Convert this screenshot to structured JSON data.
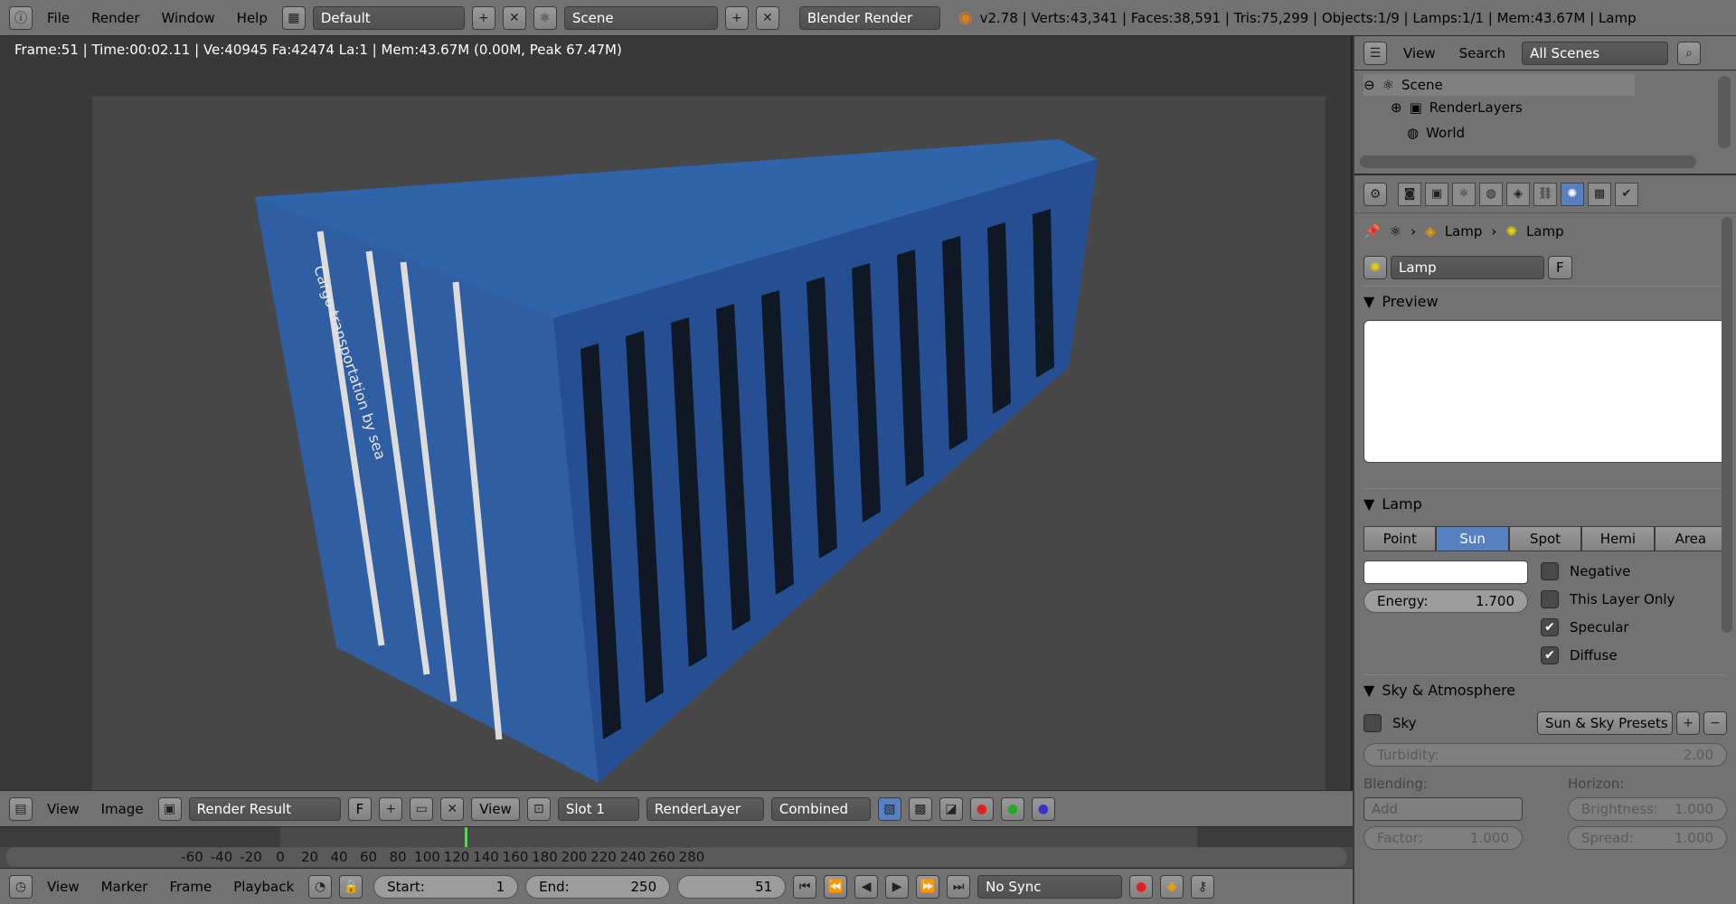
{
  "topbar": {
    "menus": [
      "File",
      "Render",
      "Window",
      "Help"
    ],
    "layout": "Default",
    "scene": "Scene",
    "engine": "Blender Render",
    "stats": "v2.78 | Verts:43,341 | Faces:38,591 | Tris:75,299 | Objects:1/9 | Lamps:1/1 | Mem:43.67M | Lamp"
  },
  "viewport": {
    "info": "Frame:51 | Time:00:02.11 | Ve:40945 Fa:42474 La:1 | Mem:43.67M (0.00M, Peak 67.47M)",
    "container_text": "Cargo transportation by sea"
  },
  "image_bar": {
    "menus": [
      "View",
      "Image"
    ],
    "image_name": "Render Result",
    "fake_user": "F",
    "view_label": "View",
    "slot": "Slot 1",
    "layer": "RenderLayer",
    "pass": "Combined"
  },
  "timeline": {
    "ticks": [
      "-60",
      "-40",
      "-20",
      "0",
      "20",
      "40",
      "60",
      "80",
      "100",
      "120",
      "140",
      "160",
      "180",
      "200",
      "220",
      "240",
      "260",
      "280"
    ],
    "current_frame": 51,
    "menus": [
      "View",
      "Marker",
      "Frame",
      "Playback"
    ],
    "start_label": "Start:",
    "start": "1",
    "end_label": "End:",
    "end": "250",
    "frame": "51",
    "sync": "No Sync"
  },
  "outliner": {
    "menus": [
      "View",
      "Search"
    ],
    "filter": "All Scenes",
    "items": [
      "Scene",
      "RenderLayers",
      "World"
    ]
  },
  "properties": {
    "breadcrumb": [
      "Lamp",
      "Lamp"
    ],
    "datablock": "Lamp",
    "fake_user": "F",
    "preview_title": "Preview",
    "lamp_title": "Lamp",
    "lamp_types": [
      "Point",
      "Sun",
      "Spot",
      "Hemi",
      "Area"
    ],
    "active_type": "Sun",
    "energy_label": "Energy:",
    "energy": "1.700",
    "checks": [
      {
        "label": "Negative",
        "checked": false
      },
      {
        "label": "This Layer Only",
        "checked": false
      },
      {
        "label": "Specular",
        "checked": true
      },
      {
        "label": "Diffuse",
        "checked": true
      }
    ],
    "sky_title": "Sky & Atmosphere",
    "sky_label": "Sky",
    "sky_presets": "Sun & Sky Presets",
    "turbidity_label": "Turbidity:",
    "turbidity": "2.00",
    "blending_label": "Blending:",
    "horizon_label": "Horizon:",
    "blend_mode": "Add",
    "brightness_label": "Brightness:",
    "brightness": "1.000",
    "factor_label": "Factor:",
    "factor": "1.000",
    "spread_label": "Spread:",
    "spread": "1.000"
  },
  "colors": {
    "accent": "#5680c2",
    "container": "#2f5ea3",
    "panel": "#727272"
  }
}
